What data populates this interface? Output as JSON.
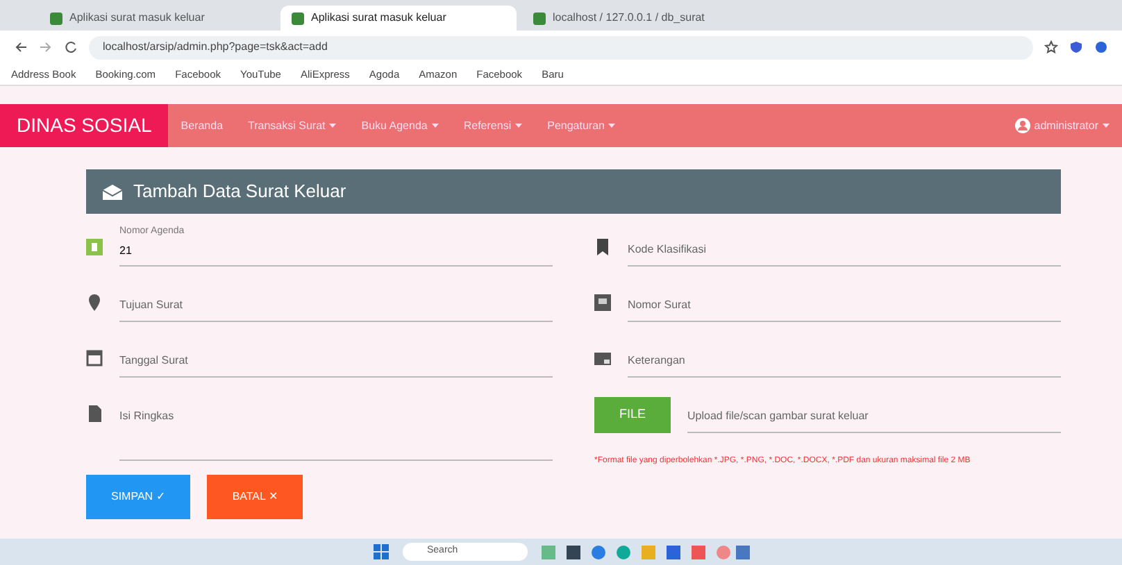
{
  "browser": {
    "tabs": [
      {
        "title": "Aplikasi surat masuk keluar",
        "selected": false
      },
      {
        "title": "Aplikasi surat masuk keluar",
        "selected": true
      },
      {
        "title": "localhost / 127.0.0.1 / db_surat",
        "selected": false
      }
    ],
    "url": "localhost/arsip/admin.php?page=tsk&act=add",
    "bookmarks": [
      "Address Book",
      "Booking.com",
      "Facebook",
      "YouTube",
      "AliExpress",
      "Agoda",
      "Amazon",
      "Facebook",
      "Baru"
    ]
  },
  "navbar": {
    "brand": "DINAS SOSIAL",
    "items": [
      {
        "label": "Beranda",
        "dropdown": false
      },
      {
        "label": "Transaksi Surat",
        "dropdown": true
      },
      {
        "label": "Buku Agenda",
        "dropdown": true
      },
      {
        "label": "Referensi",
        "dropdown": true
      },
      {
        "label": "Pengaturan",
        "dropdown": true
      }
    ],
    "user": "administrator"
  },
  "form": {
    "title": "Tambah Data Surat Keluar",
    "left": [
      {
        "kind": "text",
        "label": "Nomor Agenda",
        "value": "21"
      },
      {
        "kind": "text",
        "placeholder": "Tujuan Surat"
      },
      {
        "kind": "text",
        "placeholder": "Tanggal Surat"
      },
      {
        "kind": "textarea",
        "placeholder": "Isi Ringkas"
      }
    ],
    "right": [
      {
        "kind": "text",
        "placeholder": "Kode Klasifikasi"
      },
      {
        "kind": "text",
        "placeholder": "Nomor Surat"
      },
      {
        "kind": "text",
        "placeholder": "Keterangan"
      },
      {
        "kind": "file",
        "button": "FILE",
        "placeholder": "Upload file/scan gambar surat keluar",
        "help": "*Format file yang diperbolehkan *.JPG, *.PNG, *.DOC, *.DOCX, *.PDF dan ukuran maksimal file 2 MB"
      }
    ],
    "buttons": [
      {
        "label": "SIMPAN ✓",
        "kind": "primary"
      },
      {
        "label": "BATAL ✕",
        "kind": "cancel"
      }
    ]
  },
  "taskbar": {
    "search": "Search"
  }
}
